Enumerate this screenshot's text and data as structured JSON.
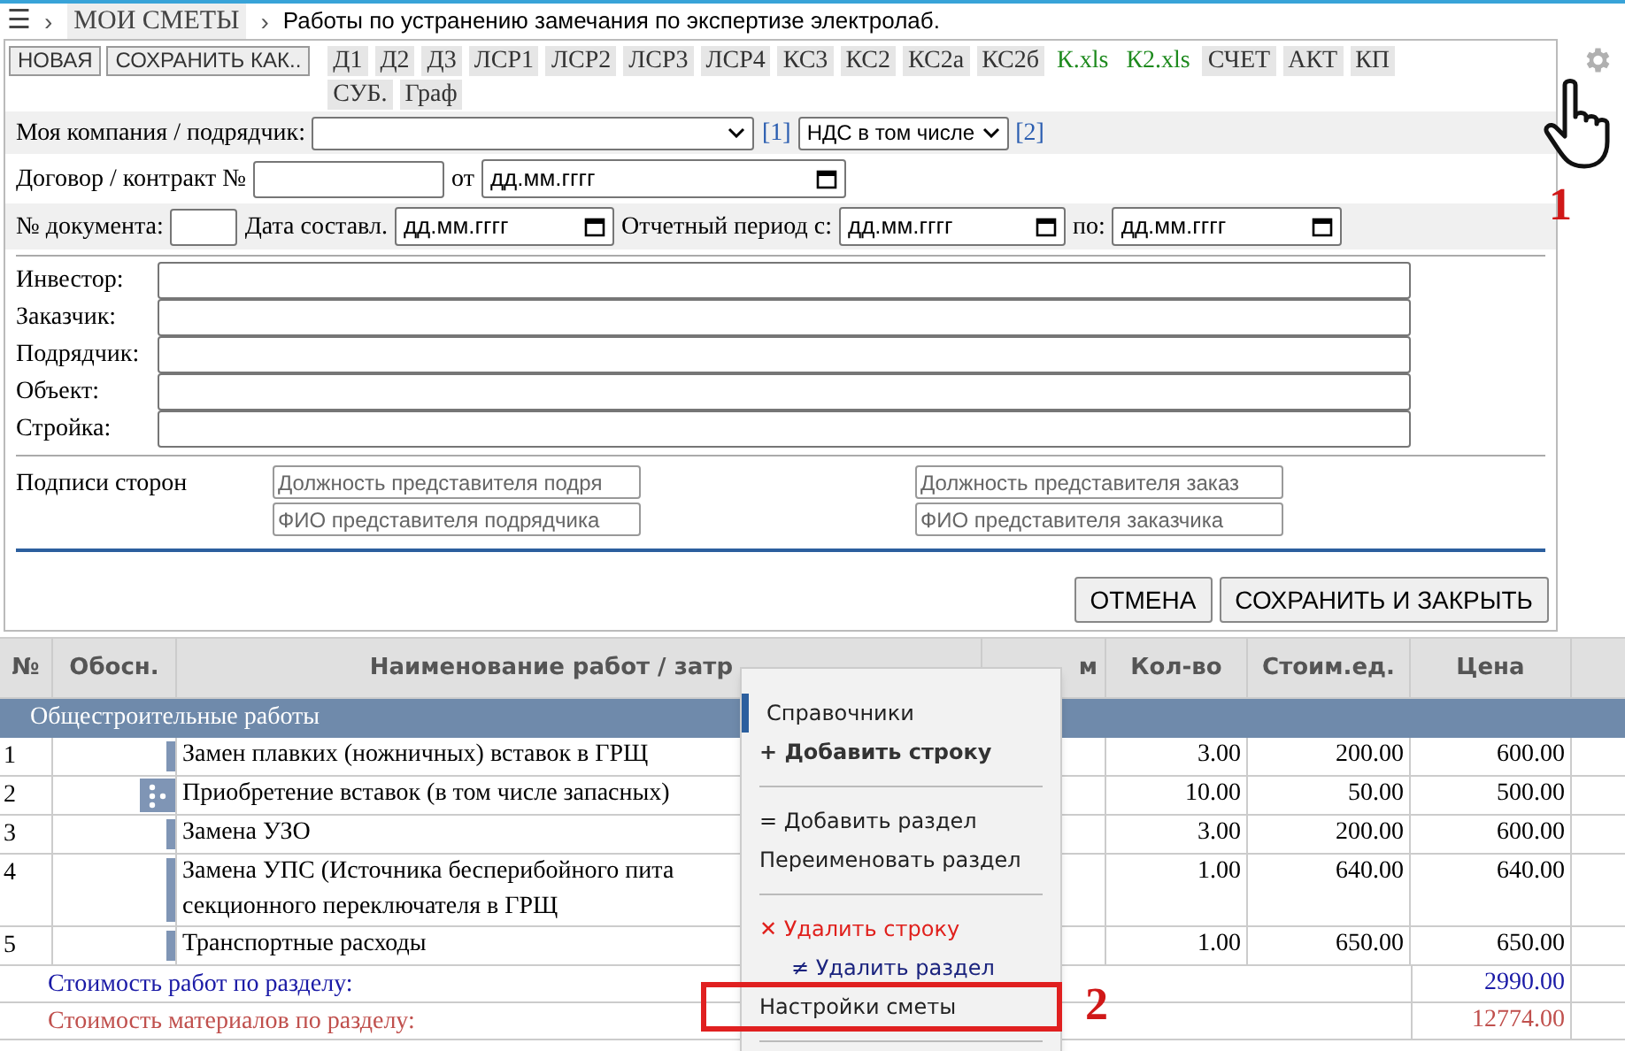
{
  "breadcrumb": {
    "menu_glyph": "☰",
    "separator": "›",
    "root": "МОИ СМЕТЫ",
    "current": "Работы по устранению замечания по экспертизе электролаб."
  },
  "toolbar": {
    "buttons": [
      "НОВАЯ",
      "СОХРАНИТЬ КАК.."
    ],
    "tabs": [
      {
        "label": "Д1",
        "kind": "tab"
      },
      {
        "label": "Д2",
        "kind": "tab"
      },
      {
        "label": "Д3",
        "kind": "tab"
      },
      {
        "label": "ЛСР1",
        "kind": "tab"
      },
      {
        "label": "ЛСР2",
        "kind": "tab"
      },
      {
        "label": "ЛСР3",
        "kind": "tab"
      },
      {
        "label": "ЛСР4",
        "kind": "tab"
      },
      {
        "label": "КС3",
        "kind": "tab"
      },
      {
        "label": "КС2",
        "kind": "tab"
      },
      {
        "label": "КС2а",
        "kind": "tab"
      },
      {
        "label": "КС2б",
        "kind": "tab"
      },
      {
        "label": "К.xls",
        "kind": "file"
      },
      {
        "label": "К2.xls",
        "kind": "file"
      },
      {
        "label": "СЧЕТ",
        "kind": "tab"
      },
      {
        "label": "АКТ",
        "kind": "tab"
      },
      {
        "label": "КП",
        "kind": "tab"
      },
      {
        "label": "СУБ.",
        "kind": "tab"
      },
      {
        "label": "Граф",
        "kind": "tab"
      }
    ]
  },
  "form": {
    "company_label": "Моя компания / подрядчик:",
    "link_1": "[1]",
    "vat_select": "НДС в том числе",
    "link_2": "[2]",
    "contract_label": "Договор / контракт №",
    "contract_from": "от",
    "contract_date_placeholder": "дд.мм.гггг",
    "doc_label": "№ документа:",
    "compiled_label": "Дата составл.",
    "compiled_date_placeholder": "дд.мм.гггг",
    "period_label": "Отчетный период с:",
    "period_from_placeholder": "дд.мм.гггг",
    "period_to": "по:",
    "period_to_placeholder": "дд.мм.гггг",
    "parties": [
      "Инвестор:",
      "Заказчик:",
      "Подрядчик:",
      "Объект:",
      "Стройка:"
    ],
    "signatures_label": "Подписи сторон",
    "signature_fields": [
      {
        "placeholder": "Должность представителя подря"
      },
      {
        "placeholder": "Должность представителя заказ"
      },
      {
        "placeholder": "ФИО представителя подрядчика"
      },
      {
        "placeholder": "ФИО представителя заказчика"
      }
    ],
    "cancel": "ОТМЕНА",
    "save_close": "СОХРАНИТЬ И ЗАКРЫТЬ"
  },
  "table": {
    "columns": [
      "№",
      "Обосн.",
      "Наименование работ / затр",
      "м",
      "Кол-во",
      "Стоим.ед.",
      "Цена"
    ],
    "section": "Общестроительные работы",
    "rows": [
      {
        "no": "1",
        "name_lines": [
          "Замен плавких (ножничных) вставок в ГРЩ"
        ],
        "qty": "3.00",
        "unit_cost": "200.00",
        "price": "600.00",
        "handle": false
      },
      {
        "no": "2",
        "name_lines": [
          "Приобретение вставок (в том числе запасных)"
        ],
        "qty": "10.00",
        "unit_cost": "50.00",
        "price": "500.00",
        "handle": true
      },
      {
        "no": "3",
        "name_lines": [
          "Замена УЗО"
        ],
        "qty": "3.00",
        "unit_cost": "200.00",
        "price": "600.00",
        "handle": false
      },
      {
        "no": "4",
        "name_lines": [
          "Замена УПС (Источника бесперибойного пита",
          "секционного переключателя в ГРЩ"
        ],
        "qty": "1.00",
        "unit_cost": "640.00",
        "price": "640.00",
        "handle": false
      },
      {
        "no": "5",
        "name_lines": [
          "Транспортные расходы"
        ],
        "qty": "1.00",
        "unit_cost": "650.00",
        "price": "650.00",
        "handle": false
      }
    ],
    "totals": [
      {
        "label": "Стоимость работ по разделу:",
        "value": "2990.00",
        "color": "#1a1aa6"
      },
      {
        "label": "Стоимость материалов по разделу:",
        "value": "12774.00",
        "color": "#c0504d"
      }
    ]
  },
  "context_menu": [
    {
      "kind": "reference",
      "label": "Справочники",
      "selected": false
    },
    {
      "kind": "add",
      "label": "+ Добавить строку",
      "selected": false
    },
    {
      "kind": "separator"
    },
    {
      "kind": "item",
      "label": "= Добавить раздел",
      "selected": false
    },
    {
      "kind": "item",
      "label": "Переименовать раздел",
      "selected": false
    },
    {
      "kind": "separator"
    },
    {
      "kind": "delete",
      "label": "✕ Удалить строку",
      "selected": false
    },
    {
      "kind": "subitem",
      "label": "≠ Удалить раздел",
      "selected": false
    },
    {
      "kind": "item",
      "label": "Настройки сметы",
      "selected": true
    },
    {
      "kind": "separator"
    }
  ],
  "annotations": [
    "1",
    "2"
  ]
}
